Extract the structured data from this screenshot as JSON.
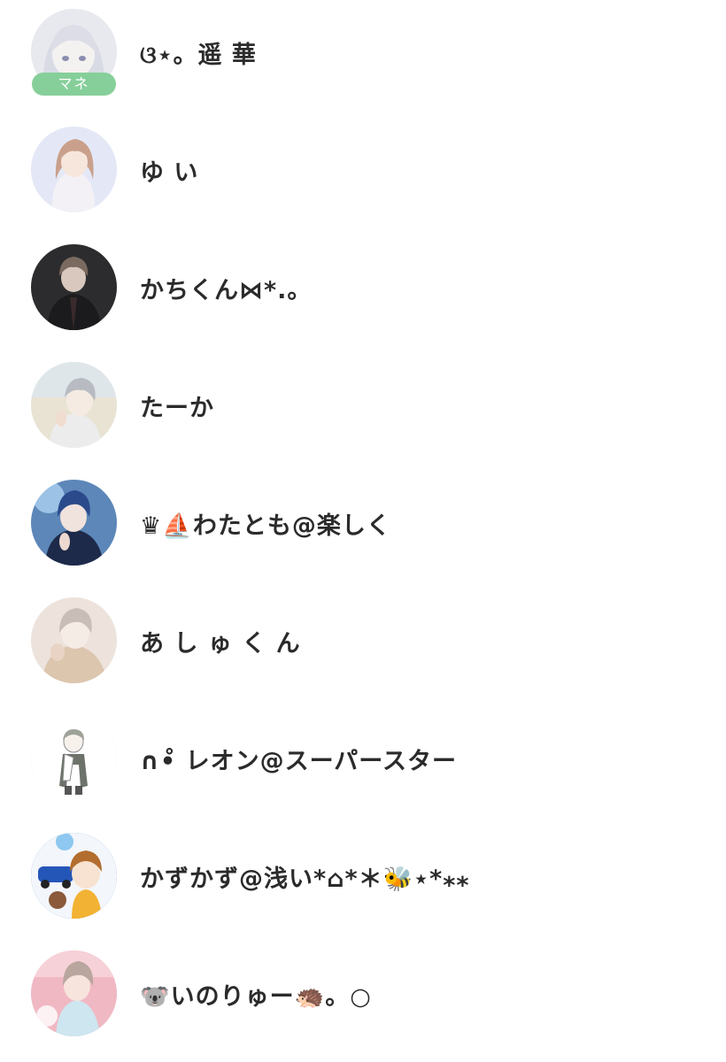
{
  "members": [
    {
      "name": "ଓ⋆。遥 華",
      "badge": "マネ"
    },
    {
      "name": "ゆ い"
    },
    {
      "name": "かちくん⋈*.。"
    },
    {
      "name": "たーか"
    },
    {
      "name": "♛⛵わたとも@楽しく"
    },
    {
      "name": "あ し ゅ く ん"
    },
    {
      "name": "∩•̊ レオン@スーパースター"
    },
    {
      "name": "かずかず@浅い*⌂*＊🐝⋆*⁎⁎"
    },
    {
      "name": "🐨いのりゅー🦔。○"
    }
  ],
  "colors": {
    "badge_bg": "#86cf9a",
    "name_text": "#2b2b2b",
    "background": "#ffffff"
  }
}
